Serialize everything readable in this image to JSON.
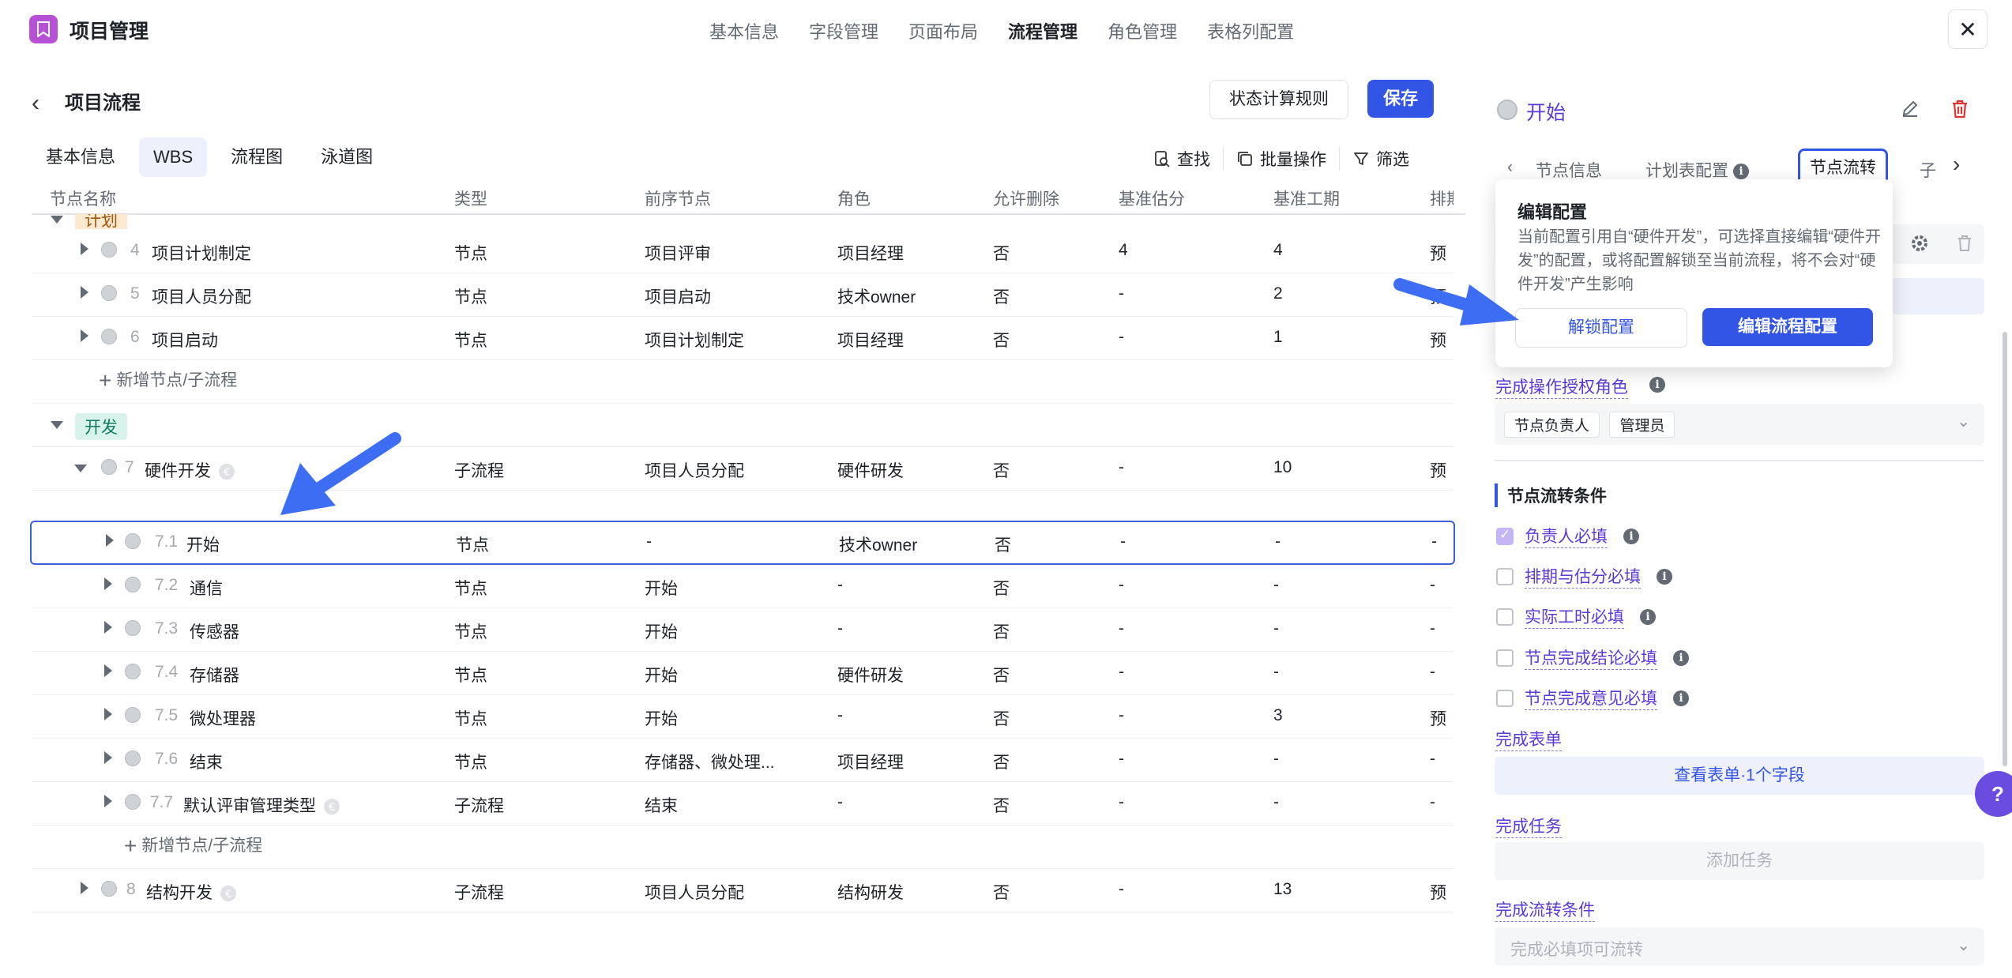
{
  "app": {
    "title": "项目管理"
  },
  "top_tabs": [
    "基本信息",
    "字段管理",
    "页面布局",
    "流程管理",
    "角色管理",
    "表格列配置"
  ],
  "top_tab_active": 3,
  "close_glyph": "✕",
  "page": {
    "back_glyph": "‹",
    "title": "项目流程",
    "rules_button": "状态计算规则",
    "save_button": "保存"
  },
  "sub_tabs": [
    "基本信息",
    "WBS",
    "流程图",
    "泳道图"
  ],
  "sub_tab_active": 1,
  "toolbar": {
    "find": "查找",
    "batch": "批量操作",
    "filter": "筛选"
  },
  "columns": [
    "节点名称",
    "类型",
    "前序节点",
    "角色",
    "允许删除",
    "基准估分",
    "基准工期",
    "排期"
  ],
  "groups": {
    "plan": "计划",
    "dev": "开发"
  },
  "rows": [
    {
      "num": "4",
      "name": "项目计划制定",
      "type": "节点",
      "prev": "项目评审",
      "role": "项目经理",
      "deletable": "否",
      "estimate": "4",
      "duration": "4",
      "schedule": "预计"
    },
    {
      "num": "5",
      "name": "项目人员分配",
      "type": "节点",
      "prev": "项目启动",
      "role": "技术owner",
      "deletable": "否",
      "estimate": "-",
      "duration": "2",
      "schedule": "预计"
    },
    {
      "num": "6",
      "name": "项目启动",
      "type": "节点",
      "prev": "项目计划制定",
      "role": "项目经理",
      "deletable": "否",
      "estimate": "-",
      "duration": "1",
      "schedule": "预计"
    },
    {
      "num": "7",
      "name": "硬件开发",
      "type": "子流程",
      "prev": "项目人员分配",
      "role": "硬件研发",
      "deletable": "否",
      "estimate": "-",
      "duration": "10",
      "schedule": "预计"
    },
    {
      "num": "7.1",
      "name": "开始",
      "type": "节点",
      "prev": "-",
      "role": "技术owner",
      "deletable": "否",
      "estimate": "-",
      "duration": "-",
      "schedule": "-"
    },
    {
      "num": "7.2",
      "name": "通信",
      "type": "节点",
      "prev": "开始",
      "role": "-",
      "deletable": "否",
      "estimate": "-",
      "duration": "-",
      "schedule": "-"
    },
    {
      "num": "7.3",
      "name": "传感器",
      "type": "节点",
      "prev": "开始",
      "role": "-",
      "deletable": "否",
      "estimate": "-",
      "duration": "-",
      "schedule": "-"
    },
    {
      "num": "7.4",
      "name": "存储器",
      "type": "节点",
      "prev": "开始",
      "role": "硬件研发",
      "deletable": "否",
      "estimate": "-",
      "duration": "-",
      "schedule": "-"
    },
    {
      "num": "7.5",
      "name": "微处理器",
      "type": "节点",
      "prev": "开始",
      "role": "-",
      "deletable": "否",
      "estimate": "-",
      "duration": "3",
      "schedule": "预计"
    },
    {
      "num": "7.6",
      "name": "结束",
      "type": "节点",
      "prev": "存储器、微处理...",
      "role": "项目经理",
      "deletable": "否",
      "estimate": "-",
      "duration": "-",
      "schedule": "-"
    },
    {
      "num": "7.7",
      "name": "默认评审管理类型",
      "type": "子流程",
      "prev": "结束",
      "role": "-",
      "deletable": "否",
      "estimate": "-",
      "duration": "-",
      "schedule": "-"
    },
    {
      "num": "8",
      "name": "结构开发",
      "type": "子流程",
      "prev": "项目人员分配",
      "role": "结构研发",
      "deletable": "否",
      "estimate": "-",
      "duration": "13",
      "schedule": "预计"
    }
  ],
  "add_node_label": "新增节点/子流程",
  "right": {
    "title": "开始",
    "tabs": {
      "prev_glyph": "‹",
      "next_glyph": "›",
      "info": "节点信息",
      "plan": "计划表配置",
      "flow": "节点流转",
      "sub": "子"
    },
    "auth_label": "完成操作授权角色",
    "auth_chips": [
      "节点负责人",
      "管理员"
    ],
    "conditions_title": "节点流转条件",
    "conditions": [
      {
        "label": "负责人必填",
        "checked": true
      },
      {
        "label": "排期与估分必填",
        "checked": false
      },
      {
        "label": "实际工时必填",
        "checked": false
      },
      {
        "label": "节点完成结论必填",
        "checked": false
      },
      {
        "label": "节点完成意见必填",
        "checked": false
      }
    ],
    "form_label": "完成表单",
    "form_button": "查看表单·1个字段",
    "task_label": "完成任务",
    "task_button": "添加任务",
    "flow_cond_label": "完成流转条件",
    "flow_cond_placeholder": "完成必填项可流转"
  },
  "popover": {
    "title": "编辑配置",
    "desc": "当前配置引用自“硬件开发”，可选择直接编辑“硬件开发”的配置，或将配置解锁至当前流程，将不会对“硬件开发”产生影响",
    "unlock": "解锁配置",
    "edit": "编辑流程配置"
  },
  "help_glyph": "?",
  "colors": {
    "primary": "#3355e6",
    "purple": "#5b3ad6",
    "arrow": "#3d6df2"
  }
}
